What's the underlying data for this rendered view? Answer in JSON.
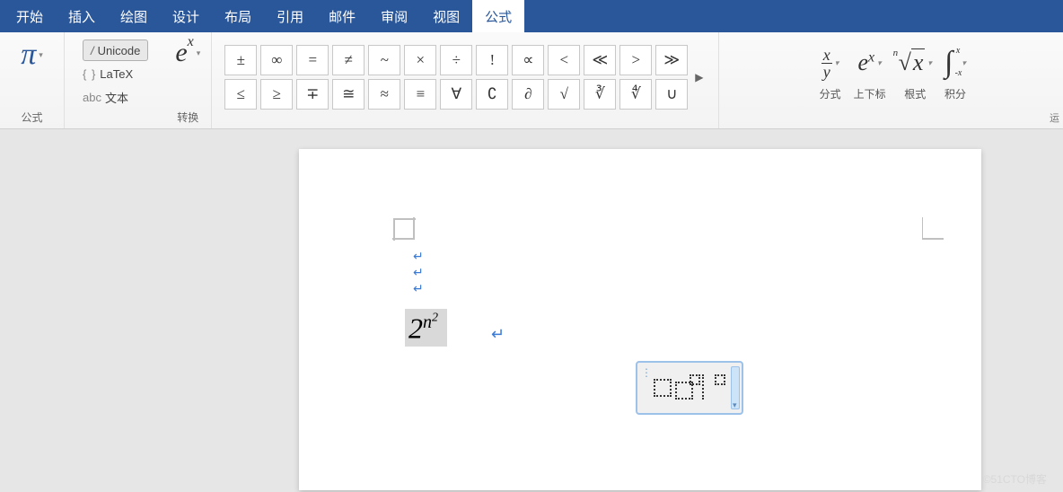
{
  "tabs": [
    "开始",
    "插入",
    "绘图",
    "设计",
    "布局",
    "引用",
    "邮件",
    "审阅",
    "视图",
    "公式"
  ],
  "active_tab_index": 9,
  "equation_group": {
    "icon": "π",
    "label": "公式"
  },
  "conversion": {
    "unicode": "Unicode",
    "unicode_prefix": "/",
    "latex": "LaTeX",
    "latex_prefix": "{ }",
    "text": "文本",
    "text_prefix": "abc",
    "ex_base": "e",
    "ex_sup": "x",
    "label": "转换"
  },
  "symbols_row1": [
    "±",
    "∞",
    "=",
    "≠",
    "~",
    "×",
    "÷",
    "!",
    "∝",
    "<",
    "≪",
    ">",
    "≫"
  ],
  "symbols_row2": [
    "≤",
    "≥",
    "∓",
    "≅",
    "≈",
    "≡",
    "∀",
    "∁",
    "∂",
    "√",
    "∛",
    "∜",
    "∪"
  ],
  "structures": [
    {
      "label": "分式"
    },
    {
      "label": "上下标"
    },
    {
      "label": "根式"
    },
    {
      "label": "积分"
    }
  ],
  "struct_frac": {
    "num": "x",
    "den": "y"
  },
  "struct_exp": {
    "base": "e",
    "sup": "x"
  },
  "struct_root": {
    "index": "n",
    "radicand": "x"
  },
  "struct_int": {
    "upper": "x",
    "lower": "-x"
  },
  "doc": {
    "equation_base": "2",
    "equation_sup": "n",
    "equation_supsup": "2"
  },
  "watermark": "©51CTO博客"
}
